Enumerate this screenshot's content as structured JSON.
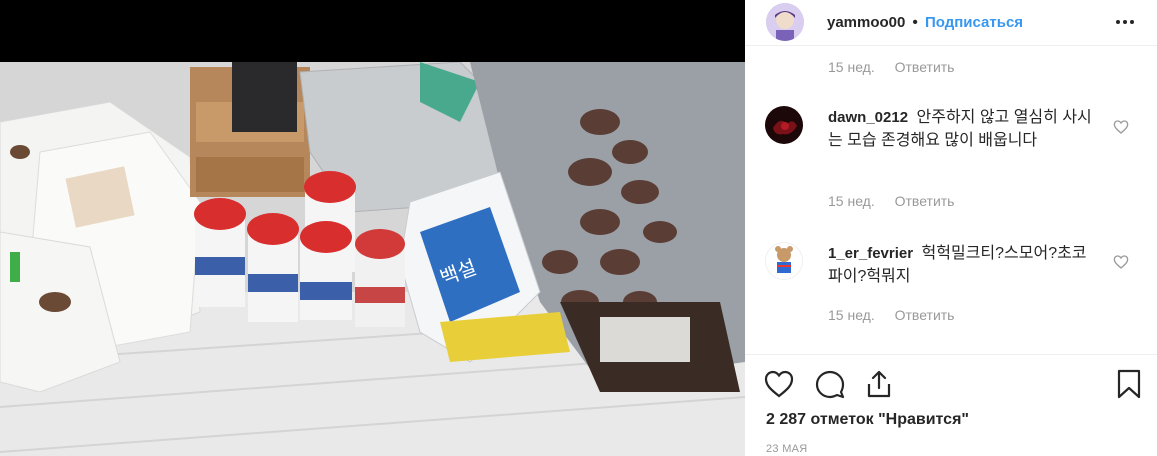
{
  "post": {
    "username": "yammoo00",
    "separator": "•",
    "follow_label": "Подписаться",
    "more_icon": "more-dots-icon"
  },
  "comments": {
    "top_meta": {
      "time": "15 нед.",
      "reply": "Ответить"
    },
    "items": [
      {
        "username": "dawn_0212",
        "text": "안주하지 않고 열심히 사시는 모습 존경해요 많이 배웁니다",
        "time": "15 нед.",
        "reply": "Ответить",
        "avatar_color": "#2a0a0c"
      },
      {
        "username": "1_er_fevrier",
        "text": "헉헉밀크티?스모어?초코파이?헉뭐지",
        "time": "15 нед.",
        "reply": "Ответить",
        "avatar_color": "#f4f4f4"
      }
    ]
  },
  "actions": {
    "like_icon": "heart-icon",
    "comment_icon": "comment-icon",
    "share_icon": "share-icon",
    "save_icon": "bookmark-icon"
  },
  "likes": {
    "text": "2 287 отметок \"Нравится\""
  },
  "date": {
    "text": "23 МАЯ"
  },
  "colors": {
    "link": "#3897f0",
    "text": "#262626",
    "muted": "#999999",
    "border": "#efefef"
  }
}
